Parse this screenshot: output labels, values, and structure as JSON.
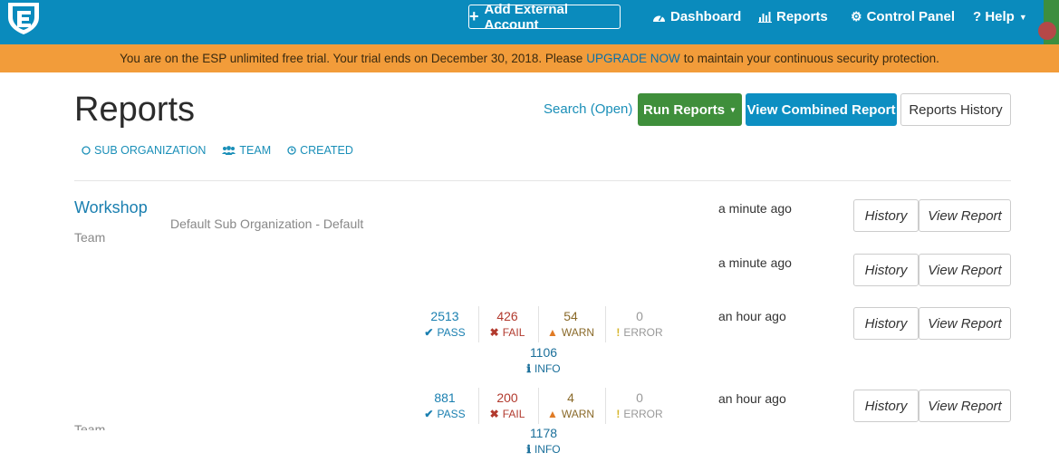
{
  "nav": {
    "logo_icon": "shield-logo",
    "add_account": "Add External Account",
    "dashboard": "Dashboard",
    "reports": "Reports",
    "control_panel": "Control Panel",
    "help": "? Help"
  },
  "banner": {
    "text_before": "You are on the ESP unlimited free trial. Your trial ends on December 30, 2018. Please",
    "upgrade_link": "UPGRADE NOW",
    "text_after": "to maintain your continuous security protection."
  },
  "header": {
    "title": "Reports",
    "search_link": "Search (Open)",
    "run_reports": "Run Reports",
    "view_combined": "View Combined Report",
    "reports_history": "Reports History",
    "filters": [
      "SUB ORGANIZATION",
      "TEAM",
      "CREATED"
    ]
  },
  "group": {
    "name": "Workshop",
    "type": "Team",
    "sub_org": "Default Sub Organization - Default",
    "faded_type": "Team"
  },
  "rows": [
    {
      "time": "a minute ago",
      "history": "History",
      "view": "View Report"
    },
    {
      "time": "a minute ago",
      "history": "History",
      "view": "View Report"
    },
    {
      "time": "an hour ago",
      "history": "History",
      "view": "View Report",
      "pass": "2513",
      "fail": "426",
      "warn": "54",
      "error": "0",
      "info": "1106"
    },
    {
      "time": "an hour ago",
      "history": "History",
      "view": "View Report",
      "pass": "881",
      "fail": "200",
      "warn": "4",
      "error": "0",
      "info": "1178"
    }
  ],
  "labels": {
    "pass": "PASS",
    "fail": "FAIL",
    "warn": "WARN",
    "error": "ERROR",
    "info": "INFO"
  },
  "colors": {
    "nav": "#0a8bbd",
    "banner": "#f29c3a",
    "run": "#3f8f3b",
    "combined": "#0d8fc2"
  }
}
